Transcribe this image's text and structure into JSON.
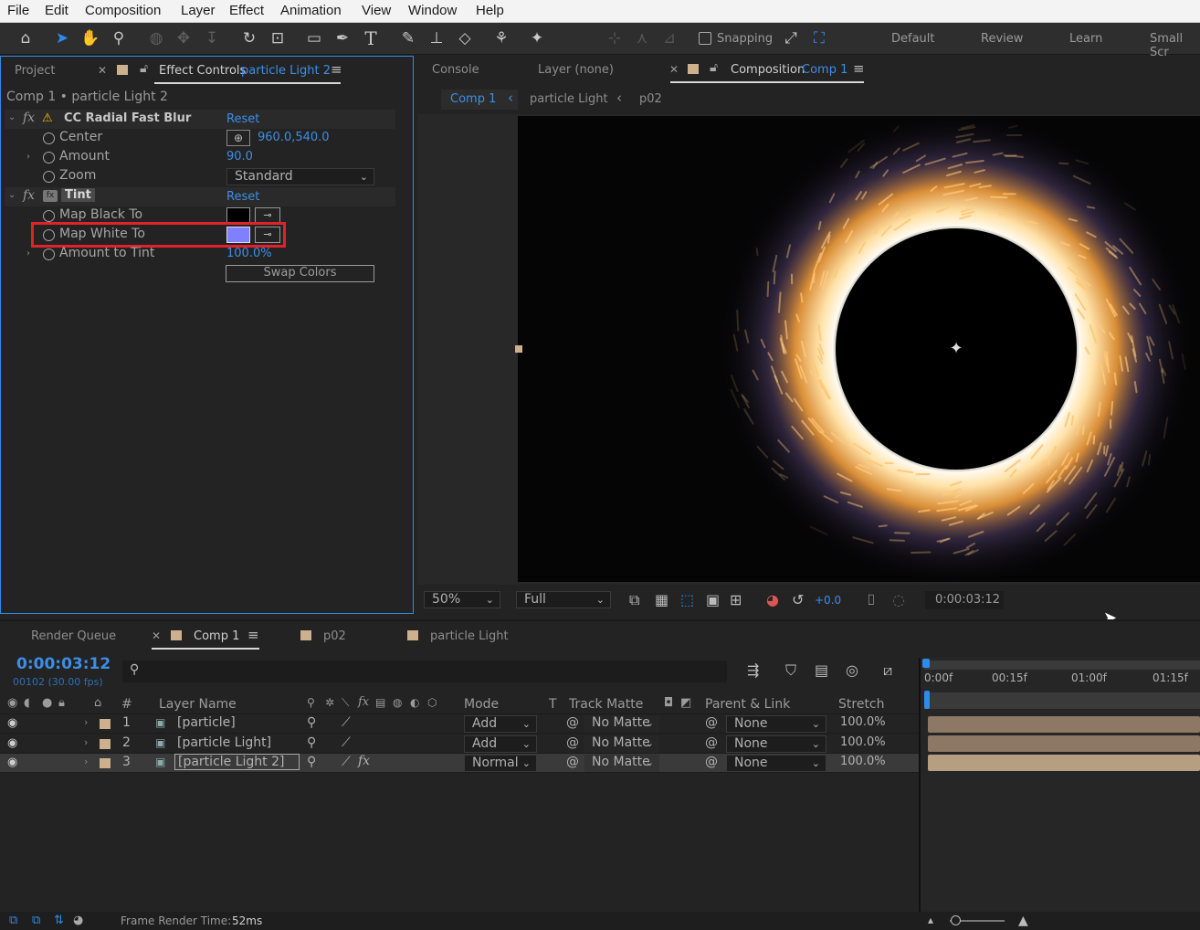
{
  "menu": [
    "File",
    "Edit",
    "Composition",
    "Layer",
    "Effect",
    "Animation",
    "View",
    "Window",
    "Help"
  ],
  "toolbar": {
    "snapping_label": "Snapping",
    "workspaces": [
      "Default",
      "Review",
      "Learn",
      "Small Scr"
    ]
  },
  "effect_panel": {
    "tab_project": "Project",
    "tab_effect_controls": "Effect Controls",
    "tab_effect_layer": "particle Light 2",
    "breadcrumb": "Comp 1 • particle Light 2",
    "effects": [
      {
        "name": "CC Radial Fast Blur",
        "reset": "Reset"
      },
      {
        "name": "Tint",
        "reset": "Reset"
      }
    ],
    "props": {
      "center_label": "Center",
      "center_value": "960.0,540.0",
      "amount_label": "Amount",
      "amount_value": "90.0",
      "zoom_label": "Zoom",
      "zoom_value": "Standard",
      "map_black_label": "Map Black To",
      "map_white_label": "Map White To",
      "amount_tint_label": "Amount to Tint",
      "amount_tint_value": "100.0%",
      "swap_colors": "Swap Colors"
    },
    "colors": {
      "map_black": "#000000",
      "map_white": "#7f80ff",
      "highlight": "#e0222a"
    }
  },
  "comp_panel": {
    "tab_console": "Console",
    "tab_layer": "Layer (none)",
    "tab_composition": "Composition",
    "tab_comp_name": "Comp 1",
    "flow": [
      "Comp 1",
      "particle Light",
      "p02"
    ],
    "zoom": "50%",
    "resolution": "Full",
    "exposure": "+0.0",
    "timecode": "0:00:03:12"
  },
  "timeline": {
    "tabs": [
      "Render Queue",
      "Comp 1",
      "p02",
      "particle Light"
    ],
    "timecode": "0:00:03:12",
    "frame_info": "00102 (30.00 fps)",
    "ruler": [
      "0:00f",
      "00:15f",
      "01:00f",
      "01:15f"
    ],
    "columns": {
      "num": "#",
      "layer_name": "Layer Name",
      "mode": "Mode",
      "t": "T",
      "track_matte": "Track Matte",
      "parent": "Parent & Link",
      "stretch": "Stretch"
    },
    "layers": [
      {
        "num": "1",
        "name": "[particle]",
        "mode": "Add",
        "matte": "No Matte",
        "parent": "None",
        "stretch": "100.0%"
      },
      {
        "num": "2",
        "name": "[particle Light]",
        "mode": "Add",
        "matte": "No Matte",
        "parent": "None",
        "stretch": "100.0%"
      },
      {
        "num": "3",
        "name": "[particle Light 2]",
        "mode": "Normal",
        "matte": "No Matte",
        "parent": "None",
        "stretch": "100.0%"
      }
    ],
    "footer": "Frame Render Time:",
    "render_time": "52ms"
  }
}
